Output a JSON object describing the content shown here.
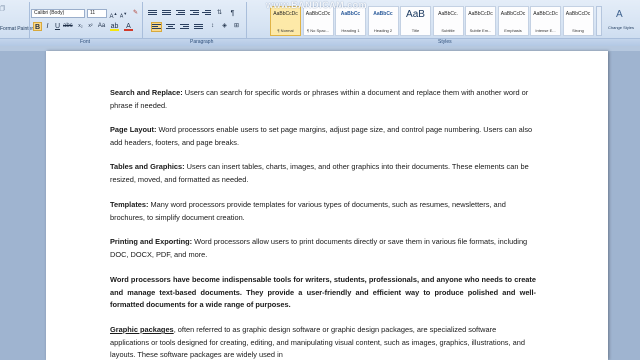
{
  "ribbon": {
    "clipboard": {
      "format_painter": "Format Painter",
      "group_label": ""
    },
    "font": {
      "name": "Calibri (Body)",
      "size": "11",
      "group_label": "Font"
    },
    "paragraph": {
      "group_label": "Paragraph"
    },
    "styles": {
      "group_label": "Styles",
      "tiles": [
        {
          "sample": "AaBbCcDc",
          "name": "¶ Normal",
          "active": true
        },
        {
          "sample": "AaBbCcDc",
          "name": "¶ No Spac...",
          "active": false
        },
        {
          "sample": "AaBbCc",
          "name": "Heading 1",
          "active": false
        },
        {
          "sample": "AaBbCc",
          "name": "Heading 2",
          "active": false
        },
        {
          "sample": "AaB",
          "name": "Title",
          "active": false
        },
        {
          "sample": "AaBbCc.",
          "name": "Subtitle",
          "active": false
        },
        {
          "sample": "AaBbCcDc",
          "name": "Subtle Em...",
          "active": false
        },
        {
          "sample": "AaBbCcDc",
          "name": "Emphasis",
          "active": false
        },
        {
          "sample": "AaBbCcDc",
          "name": "Intense E...",
          "active": false
        },
        {
          "sample": "AaBbCcDc",
          "name": "Strong",
          "active": false
        }
      ],
      "change_styles": "Change Styles"
    }
  },
  "watermark": {
    "main": "www.BANDICAM.com"
  },
  "document": {
    "p1": {
      "term": "Search and Replace:",
      "text": " Users can search for specific words or phrases within a document and replace them with another word or phrase if needed."
    },
    "p2": {
      "term": "Page Layout:",
      "text": " Word processors enable users to set page margins, adjust page size, and control page numbering. Users can also add headers, footers, and page breaks."
    },
    "p3": {
      "term": "Tables and Graphics:",
      "text": " Users can insert tables, charts, images, and other graphics into their documents. These elements can be resized, moved, and formatted as needed."
    },
    "p4": {
      "term": "Templates:",
      "text": " Many word processors provide templates for various types of documents, such as resumes, newsletters, and brochures, to simplify document creation."
    },
    "p5": {
      "term": "Printing and Exporting:",
      "text": " Word processors allow users to print documents directly or save them in various file formats, including DOC, DOCX, PDF, and more."
    },
    "p6": {
      "text": "Word processors have become indispensable tools for writers, students, professionals, and anyone who needs to create and manage text-based documents. They provide a user-friendly and efficient way to produce polished and well-formatted documents for a wide range of purposes."
    },
    "p7": {
      "term": "Graphic packages",
      "text": ", often referred to as graphic design software or graphic design packages, are specialized software applications or tools designed for creating, editing, and manipulating visual content, such as images, graphics, illustrations, and layouts. These software packages are widely used in"
    }
  }
}
